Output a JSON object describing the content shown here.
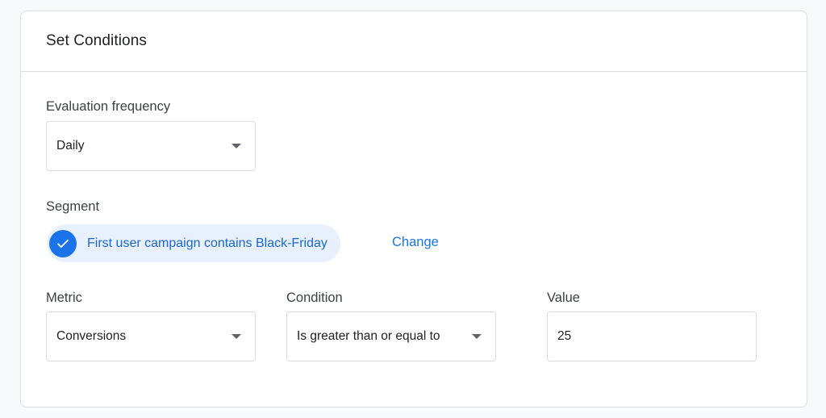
{
  "card": {
    "title": "Set Conditions"
  },
  "evaluation_frequency": {
    "label": "Evaluation frequency",
    "value": "Daily"
  },
  "segment": {
    "label": "Segment",
    "chip_label": "First user campaign contains Black-Friday",
    "change_label": "Change"
  },
  "metric": {
    "label": "Metric",
    "value": "Conversions"
  },
  "condition": {
    "label": "Condition",
    "value": "Is greater than or equal to"
  },
  "value_field": {
    "label": "Value",
    "value": "25"
  },
  "colors": {
    "accent": "#1a73e8",
    "chip_background": "#e8f0fe",
    "border": "#dadce0"
  },
  "icons": {
    "check": "check-icon",
    "dropdown": "caret-down-icon"
  }
}
